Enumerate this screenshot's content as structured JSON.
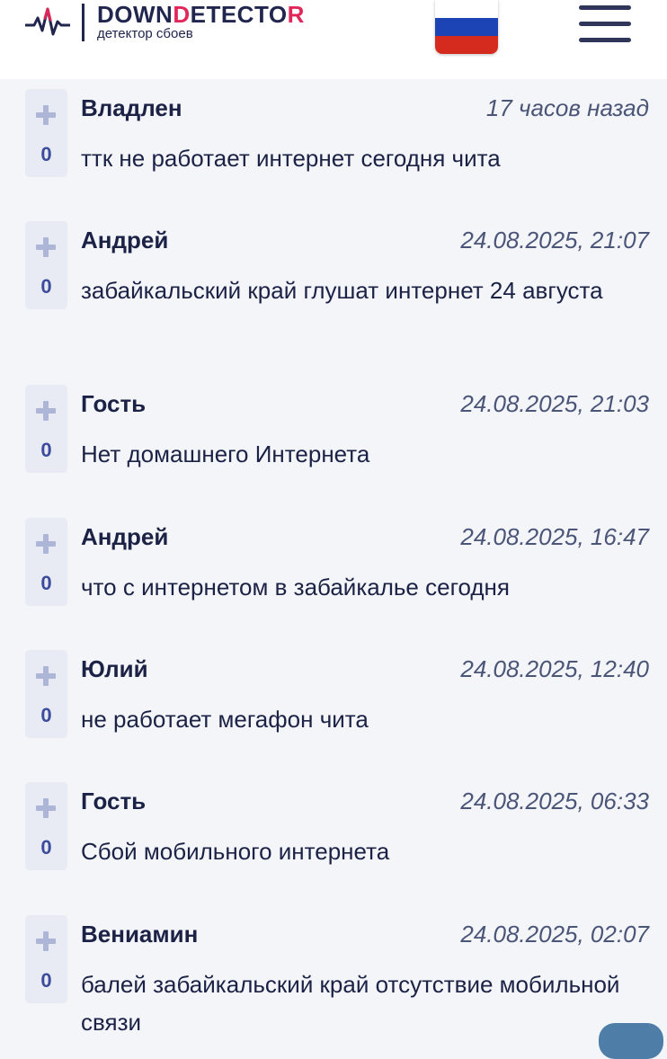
{
  "header": {
    "logo_part1": "DOWN",
    "logo_d": "D",
    "logo_part2": "ETECTO",
    "logo_r": "R",
    "subtitle": "детектор сбоев",
    "flag_icon": "russia-flag-icon",
    "menu_icon": "hamburger-menu-icon"
  },
  "colors": {
    "accent": "#e1275a",
    "brand": "#21264f",
    "vote_bg": "#e8ebf3",
    "vote_count": "#3c4b9c"
  },
  "comments": [
    {
      "author": "Владлен",
      "time": "17 часов назад",
      "votes": "0",
      "text": "ттк не работает интернет сегодня чита"
    },
    {
      "author": "Андрей",
      "time": "24.08.2025, 21:07",
      "votes": "0",
      "text": "забайкальский край глушат интернет 24 августа"
    },
    {
      "author": "Гость",
      "time": "24.08.2025, 21:03",
      "votes": "0",
      "text": "Нет домашнего Интернета"
    },
    {
      "author": "Андрей",
      "time": "24.08.2025, 16:47",
      "votes": "0",
      "text": "что с интернетом в забайкалье сегодня"
    },
    {
      "author": "Юлий",
      "time": "24.08.2025, 12:40",
      "votes": "0",
      "text": "не работает мегафон чита"
    },
    {
      "author": "Гость",
      "time": "24.08.2025, 06:33",
      "votes": "0",
      "text": "Сбой мобильного интернета"
    },
    {
      "author": "Вениамин",
      "time": "24.08.2025, 02:07",
      "votes": "0",
      "text": "балей забайкальский край отсутствие мобильной связи"
    }
  ]
}
